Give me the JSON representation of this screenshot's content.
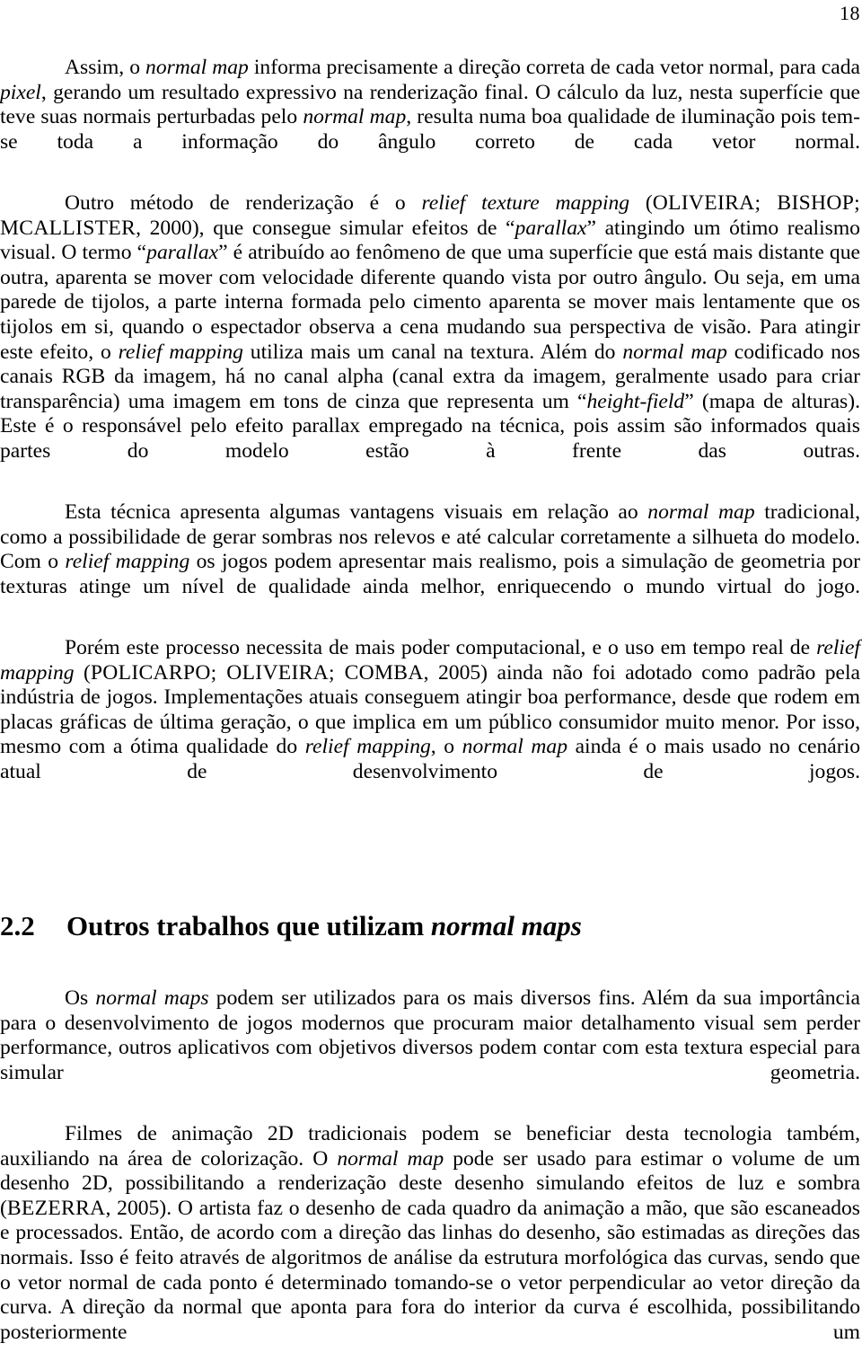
{
  "page": {
    "number": "18",
    "language": "pt-BR"
  },
  "section": {
    "number": "2.2",
    "title_plain": "Outros trabalhos que utilizam ",
    "title_italic": "normal maps"
  },
  "paragraphs": {
    "p1": {
      "lead": "Assim, o ",
      "i1": "normal map",
      "t1": " informa precisamente a direção correta de cada vetor normal, para cada ",
      "i2": "pixel",
      "t2": ", gerando um resultado expressivo na renderização final. O cálculo da luz, nesta superfície que teve suas normais perturbadas pelo ",
      "i3": "normal map",
      "t3": ", resulta numa boa qualidade de iluminação pois tem-se toda a informação do ângulo correto de cada vetor normal."
    },
    "p2": {
      "t0": "Outro método de renderização é o ",
      "i1": "relief texture mapping",
      "t1": " (",
      "sc1": "OLIVEIRA; BISHOP; MCALLISTER",
      "t2": ", 2000), que consegue simular efeitos de “",
      "i2": "parallax",
      "t3": "” atingindo um ótimo realismo visual. O termo “",
      "i3": "parallax",
      "t4": "” é atribuído ao fenômeno de que uma superfície que está mais distante que outra, aparenta se mover com velocidade diferente quando vista por outro ângulo. Ou seja, em uma parede de tijolos, a parte interna formada pelo cimento aparenta se mover mais lentamente que os tijolos em si, quando o espectador observa a cena mudando sua perspectiva de visão. Para atingir este efeito, o ",
      "i4": "relief mapping",
      "t5": " utiliza mais um canal na textura. Além do ",
      "i5": "normal map",
      "t6": " codificado nos canais RGB da imagem, há no canal alpha (canal extra da imagem, geralmente usado para criar transparência) uma imagem em tons de cinza que representa um “",
      "i6": "height-field",
      "t7": "” (mapa de alturas). Este é o responsável pelo efeito parallax empregado na técnica, pois assim são informados quais partes do modelo estão à frente das outras."
    },
    "p3": {
      "t0": "Esta técnica apresenta algumas vantagens visuais em relação ao ",
      "i1": "normal map",
      "t1": " tradicional, como a possibilidade de gerar sombras nos relevos e até calcular corretamente a silhueta do modelo. Com o ",
      "i2": "relief mapping",
      "t2": " os jogos podem apresentar mais realismo, pois a simulação de geometria por texturas atinge um nível de qualidade ainda melhor, enriquecendo o mundo virtual do jogo."
    },
    "p4": {
      "t0": "Porém este processo necessita de mais poder computacional, e o uso em tempo real de ",
      "i1": "relief mapping",
      "t1": " (",
      "sc1": "POLICARPO; OLIVEIRA; COMBA",
      "t2": ", 2005) ainda não foi adotado como padrão pela indústria de jogos. Implementações atuais conseguem atingir boa performance, desde que rodem em placas gráficas de última geração, o que implica em um público consumidor muito menor. Por isso, mesmo com a ótima qualidade do ",
      "i2": "relief mapping",
      "t3": ", o ",
      "i3": "normal map",
      "t4": " ainda é o mais usado no cenário atual de desenvolvimento de jogos."
    },
    "p5": {
      "t0": "Os ",
      "i1": "normal maps",
      "t1": " podem ser utilizados para os mais diversos fins. Além da sua importância para o desenvolvimento de jogos modernos que procuram maior detalhamento visual sem perder performance, outros aplicativos com objetivos diversos podem contar com esta textura especial para simular geometria."
    },
    "p6": {
      "t0": "Filmes de animação 2D tradicionais podem se beneficiar desta tecnologia também, auxiliando na área de colorização. O ",
      "i1": "normal map",
      "t1": " pode ser usado para estimar o volume de um desenho 2D, possibilitando a renderização deste desenho simulando efeitos de luz e sombra (",
      "sc1": "BEZERRA",
      "t2": ", 2005). O artista faz o desenho de cada quadro da animação a mão, que são escaneados e processados. Então, de acordo com a direção das linhas do desenho, são estimadas as direções das normais. Isso é feito através de algoritmos de análise da estrutura morfológica das curvas, sendo que o vetor normal de cada ponto é determinado tomando-se o vetor perpendicular ao vetor direção da curva. A direção da normal que aponta para fora do interior da curva é escolhida, possibilitando posteriormente um"
    }
  }
}
